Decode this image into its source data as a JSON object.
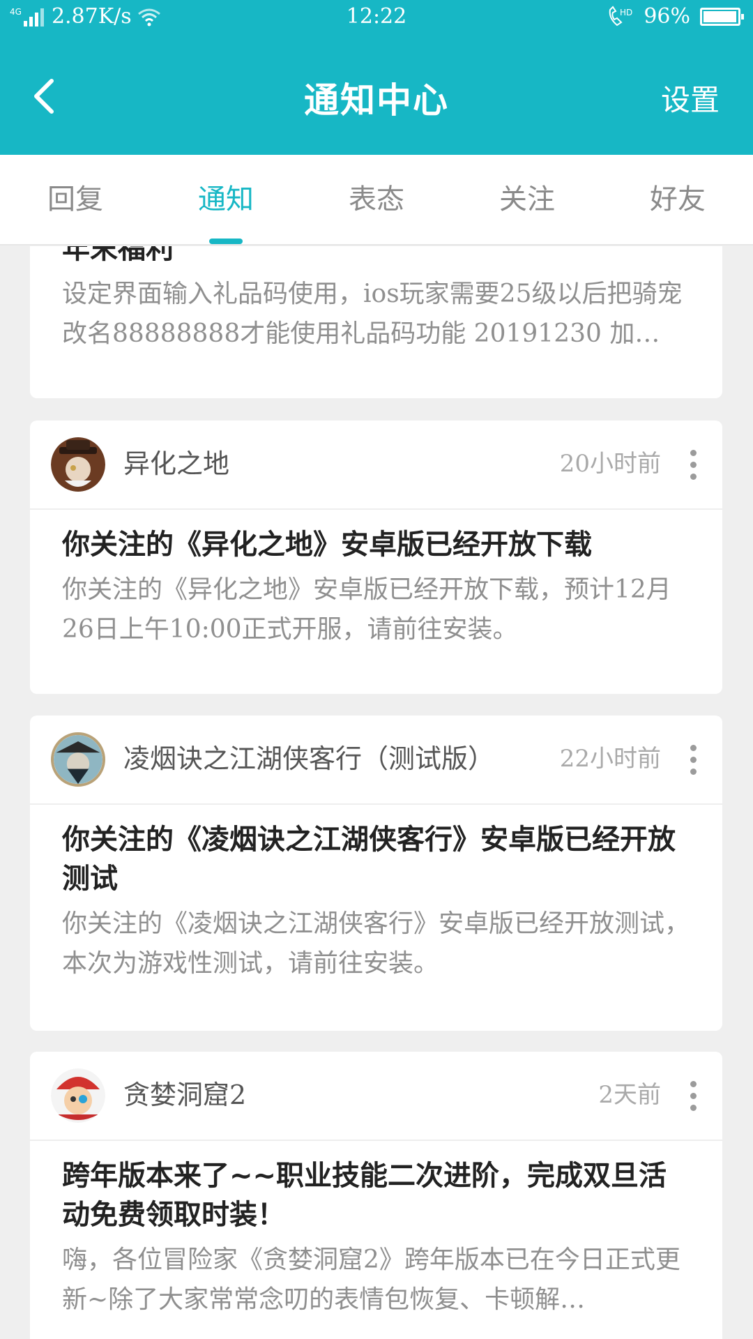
{
  "status_bar": {
    "network": "4G",
    "speed": "2.87K/s",
    "time": "12:22",
    "battery": "96%",
    "battery_level": 0.96
  },
  "header": {
    "back_icon": "chevron-left-icon",
    "title": "通知中心",
    "settings": "设置",
    "color": "#17b7c5"
  },
  "tabs": [
    {
      "label": "回复",
      "active": false
    },
    {
      "label": "通知",
      "active": true
    },
    {
      "label": "表态",
      "active": false
    },
    {
      "label": "关注",
      "active": false
    },
    {
      "label": "好友",
      "active": false
    }
  ],
  "cards": [
    {
      "title": "年末福利",
      "desc": "设定界面输入礼品码使用，ios玩家需要25级以后把骑宠改名88888888才能使用礼品码功能 20191230 加…"
    },
    {
      "game": "异化之地",
      "time": "20小时前",
      "title": "你关注的《异化之地》安卓版已经开放下载",
      "desc": "你关注的《异化之地》安卓版已经开放下载，预计12月26日上午10:00正式开服，请前往安装。"
    },
    {
      "game": "凌烟诀之江湖侠客行（测试版）",
      "time": "22小时前",
      "title": "你关注的《凌烟诀之江湖侠客行》安卓版已经开放测试",
      "desc": "你关注的《凌烟诀之江湖侠客行》安卓版已经开放测试，本次为游戏性测试，请前往安装。"
    },
    {
      "game": "贪婪洞窟2",
      "time": "2天前",
      "title": "跨年版本来了~~职业技能二次进阶，完成双旦活动免费领取时装！",
      "desc": "嗨，各位冒险家《贪婪洞窟2》跨年版本已在今日正式更新~除了大家常常念叨的表情包恢复、卡顿解…"
    }
  ]
}
